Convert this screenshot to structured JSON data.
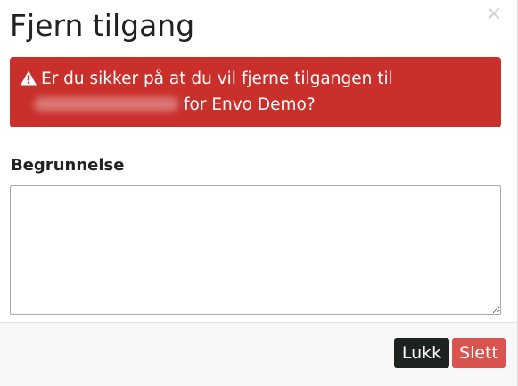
{
  "dialog": {
    "title": "Fjern tilgang",
    "close_glyph": "×",
    "alert": {
      "icon": "warning-triangle-icon",
      "line1": "Er du sikker på at du vil fjerne tilgangen til",
      "line2_suffix": "for Envo Demo?",
      "color": "#c9302c"
    },
    "field": {
      "label": "Begrunnelse",
      "value": ""
    },
    "buttons": {
      "close_label": "Lukk",
      "delete_label": "Slett",
      "close_color": "#1d2420",
      "delete_color": "#d9534f"
    }
  }
}
